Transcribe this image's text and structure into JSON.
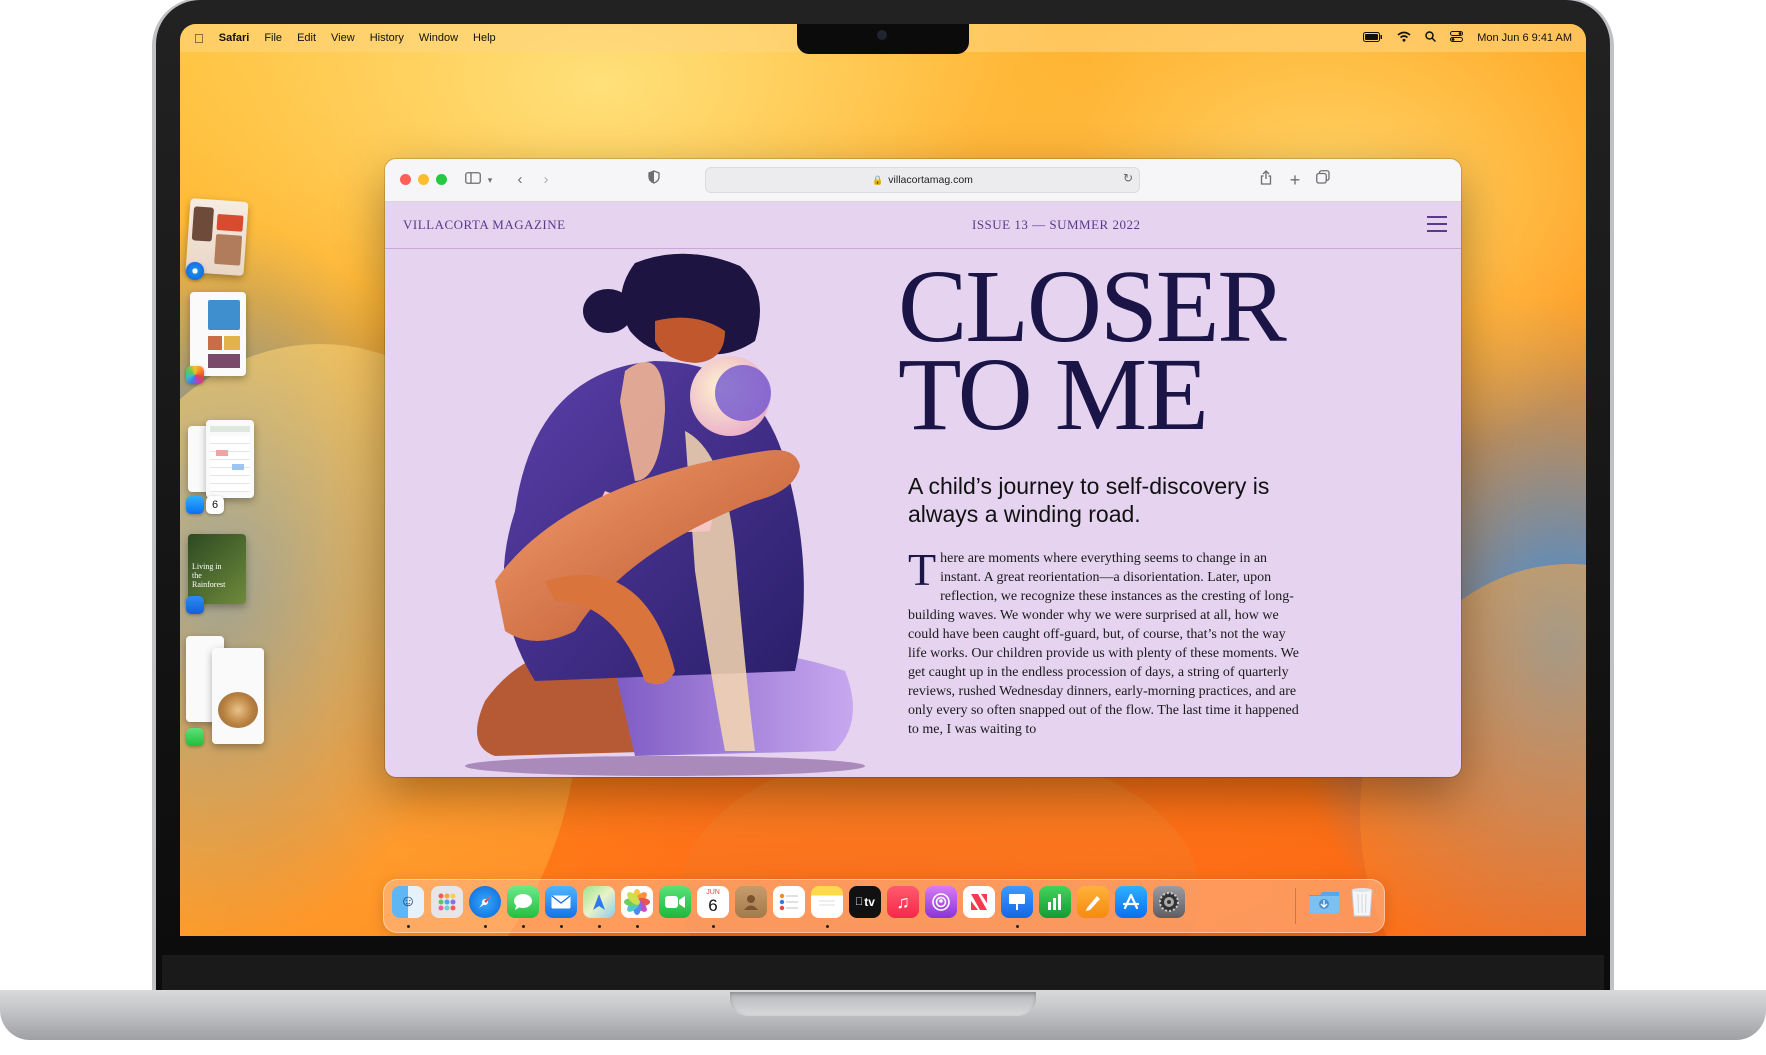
{
  "menubar": {
    "apple_icon": "apple-icon",
    "app_name": "Safari",
    "items": [
      "File",
      "Edit",
      "View",
      "History",
      "Window",
      "Help"
    ],
    "datetime": "Mon Jun 6  9:41 AM"
  },
  "safari": {
    "address": "villacortamag.com",
    "magazine_name": "VILLACORTA MAGAZINE",
    "issue": "ISSUE 13 — SUMMER 2022",
    "headline_line1": "CLOSER",
    "headline_line2": "TO ME",
    "subheadline": "A child’s journey to self-discovery is always a winding road.",
    "dropcap": "T",
    "body": "here are moments where everything seems to change in an instant. A great reorientation—a disorientation. Later, upon reflection, we recognize these instances as the cresting of long-building waves. We wonder why we were surprised at all, how we could have been caught off-guard, but, of course, that’s not the way life works. Our children provide us with plenty of these moments. We get caught up in the endless procession of days, a string of quarterly reviews, rushed Wednesday dinners, early-morning practices, and are only every so often snapped out of the flow. The last time it happened to me, I was waiting to"
  },
  "stage_manager": {
    "calendar_day": "6",
    "keynote_caption": "Living in the Rainforest"
  },
  "dock": {
    "calendar_month": "JUN",
    "calendar_day": "6",
    "tv_label": "tv",
    "icons": [
      "finder-icon",
      "launchpad-icon",
      "safari-icon",
      "messages-icon",
      "mail-icon",
      "maps-icon",
      "photos-icon",
      "facetime-icon",
      "calendar-icon",
      "contacts-icon",
      "reminders-icon",
      "notes-icon",
      "appletv-icon",
      "music-icon",
      "podcasts-icon",
      "news-icon",
      "keynote-icon",
      "numbers-icon",
      "pages-icon",
      "appstore-icon",
      "settings-icon",
      "downloads-folder-icon",
      "trash-icon"
    ]
  },
  "colors": {
    "accent_purple": "#5b3a8a",
    "page_background": "#e5d3f0",
    "headline": "#1b1446"
  }
}
